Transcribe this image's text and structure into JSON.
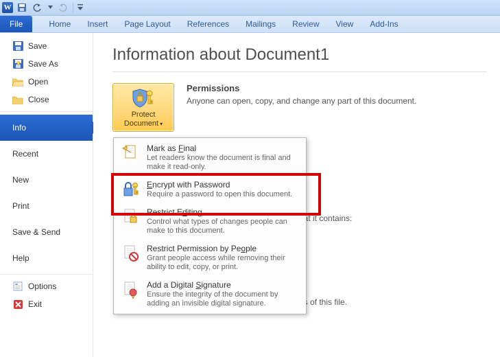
{
  "titlebar": {
    "app_letter": "W"
  },
  "ribbon": {
    "file": "File",
    "tabs": [
      "Home",
      "Insert",
      "Page Layout",
      "References",
      "Mailings",
      "Review",
      "View",
      "Add-Ins"
    ]
  },
  "sidebar": {
    "top": [
      {
        "label": "Save",
        "icon": "save-icon"
      },
      {
        "label": "Save As",
        "icon": "save-as-icon"
      },
      {
        "label": "Open",
        "icon": "open-icon"
      },
      {
        "label": "Close",
        "icon": "close-file-icon"
      }
    ],
    "active": "Info",
    "middle": [
      "Recent",
      "New",
      "Print",
      "Save & Send",
      "Help"
    ],
    "bottom": [
      {
        "label": "Options",
        "icon": "options-icon"
      },
      {
        "label": "Exit",
        "icon": "exit-icon"
      }
    ]
  },
  "main": {
    "title": "Information about Document1",
    "permissions": {
      "heading": "Permissions",
      "text": "Anyone can open, copy, and change any part of this document."
    },
    "protect_button": {
      "line1": "Protect",
      "line2": "Document",
      "arrow": "▾"
    },
    "background_hints": {
      "contains_tail": "hat it contains:",
      "versions_tail": "ns of this file."
    }
  },
  "dropdown": {
    "items": [
      {
        "title_pre": "Mark as ",
        "title_u": "F",
        "title_post": "inal",
        "desc": "Let readers know the document is final and make it read-only.",
        "icon": "mark-final-icon"
      },
      {
        "title_pre": "",
        "title_u": "E",
        "title_post": "ncrypt with Password",
        "desc": "Require a password to open this document.",
        "icon": "encrypt-password-icon"
      },
      {
        "title_pre": "Restrict E",
        "title_u": "d",
        "title_post": "iting",
        "desc": "Control what types of changes people can make to this document.",
        "icon": "restrict-editing-icon"
      },
      {
        "title_pre": "Restrict Permission by Pe",
        "title_u": "o",
        "title_post": "ple",
        "desc": "Grant people access while removing their ability to edit, copy, or print.",
        "icon": "restrict-people-icon"
      },
      {
        "title_pre": "Add a Digital ",
        "title_u": "S",
        "title_post": "ignature",
        "desc": "Ensure the integrity of the document by adding an invisible digital signature.",
        "icon": "digital-signature-icon"
      }
    ]
  },
  "colors": {
    "ribbon_blue": "#1e56b6",
    "highlight_red": "#d40000",
    "protect_gold": "#ffd77a"
  }
}
